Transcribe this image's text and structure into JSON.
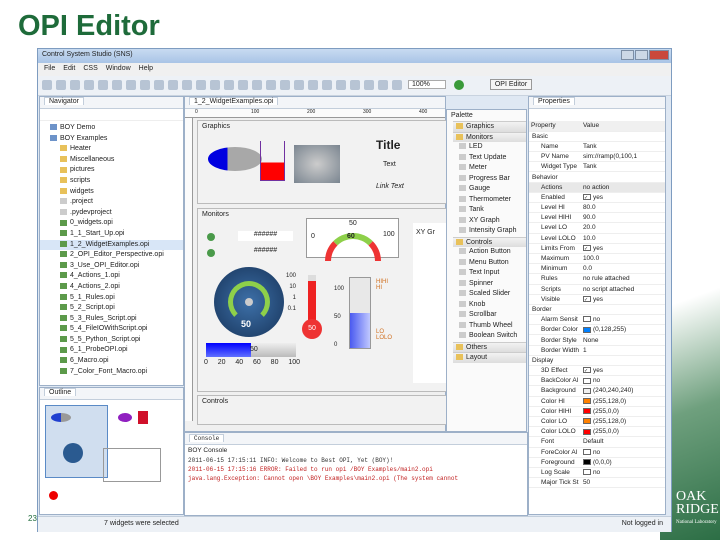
{
  "slide": {
    "title": "OPI Editor",
    "page_number": "23",
    "logo_text": "OAK RIDGE",
    "logo_sub": "National Laboratory"
  },
  "window": {
    "title": "Control System Studio (SNS)",
    "menu": [
      "File",
      "Edit",
      "CSS",
      "Window",
      "Help"
    ],
    "zoom": "100%",
    "perspective": "OPI Editor"
  },
  "navigator": {
    "tab": "Navigator",
    "items": [
      {
        "label": "BOY Demo",
        "type": "project",
        "indent": 1
      },
      {
        "label": "BOY Examples",
        "type": "project",
        "indent": 1
      },
      {
        "label": "Heater",
        "type": "folder",
        "indent": 2
      },
      {
        "label": "Miscellaneous",
        "type": "folder",
        "indent": 2
      },
      {
        "label": "pictures",
        "type": "folder",
        "indent": 2
      },
      {
        "label": "scripts",
        "type": "folder",
        "indent": 2
      },
      {
        "label": "widgets",
        "type": "folder",
        "indent": 2
      },
      {
        "label": ".project",
        "type": "file",
        "indent": 2
      },
      {
        "label": ".pydevproject",
        "type": "file",
        "indent": 2
      },
      {
        "label": "0_widgets.opi",
        "type": "opi",
        "indent": 2
      },
      {
        "label": "1_1_Start_Up.opi",
        "type": "opi",
        "indent": 2
      },
      {
        "label": "1_2_WidgetExamples.opi",
        "type": "opi",
        "indent": 2,
        "selected": true
      },
      {
        "label": "2_OPI_Editor_Perspective.opi",
        "type": "opi",
        "indent": 2
      },
      {
        "label": "3_Use_OPI_Editor.opi",
        "type": "opi",
        "indent": 2
      },
      {
        "label": "4_Actions_1.opi",
        "type": "opi",
        "indent": 2
      },
      {
        "label": "4_Actions_2.opi",
        "type": "opi",
        "indent": 2
      },
      {
        "label": "5_1_Rules.opi",
        "type": "opi",
        "indent": 2
      },
      {
        "label": "5_2_Script.opi",
        "type": "opi",
        "indent": 2
      },
      {
        "label": "5_3_Rules_Script.opi",
        "type": "opi",
        "indent": 2
      },
      {
        "label": "5_4_FileIOWithScript.opi",
        "type": "opi",
        "indent": 2
      },
      {
        "label": "5_5_Python_Script.opi",
        "type": "opi",
        "indent": 2
      },
      {
        "label": "6_1_ProbeOPI.opi",
        "type": "opi",
        "indent": 2
      },
      {
        "label": "6_Macro.opi",
        "type": "opi",
        "indent": 2
      },
      {
        "label": "7_Color_Font_Macro.opi",
        "type": "opi",
        "indent": 2
      }
    ]
  },
  "outline": {
    "tab": "Outline"
  },
  "editor": {
    "tab": "1_2_WidgetExamples.opi",
    "ruler": [
      "0",
      "100",
      "200",
      "300",
      "400"
    ],
    "graphics": {
      "label": "Graphics",
      "title": "Title",
      "text": "Text",
      "link": "Link Text"
    },
    "monitors": {
      "label": "Monitors",
      "text_updates": [
        "######",
        "######"
      ],
      "meter_ticks": [
        "0",
        "50",
        "100"
      ],
      "meter_value": "60",
      "gauge_ticks": [
        "0",
        "20",
        "40",
        "60",
        "80",
        "100"
      ],
      "gauge_value": "50",
      "thermo_ticks": [
        "100",
        "10",
        "1",
        "0.1"
      ],
      "thermo_value": "50",
      "tank_ticks": [
        "100",
        "50",
        "0"
      ],
      "tank_levels": [
        "HIHI",
        "HI",
        "LO",
        "LOLO"
      ],
      "progress_value": "50",
      "progress_ticks": [
        "0",
        "20",
        "40",
        "60",
        "80",
        "100"
      ],
      "xy_label": "XY Gr"
    },
    "controls": {
      "label": "Controls"
    },
    "level_fraction": 0.5
  },
  "palette": {
    "title": "Palette",
    "items": [
      {
        "label": "Graphics",
        "category": true
      },
      {
        "label": "Monitors",
        "category": true
      },
      {
        "label": "LED"
      },
      {
        "label": "Text Update"
      },
      {
        "label": "Meter"
      },
      {
        "label": "Progress Bar"
      },
      {
        "label": "Gauge"
      },
      {
        "label": "Thermometer"
      },
      {
        "label": "Tank"
      },
      {
        "label": "XY Graph"
      },
      {
        "label": "Intensity Graph"
      },
      {
        "label": "Controls",
        "category": true
      },
      {
        "label": "Action Button"
      },
      {
        "label": "Menu Button"
      },
      {
        "label": "Text Input"
      },
      {
        "label": "Spinner"
      },
      {
        "label": "Scaled Slider"
      },
      {
        "label": "Knob"
      },
      {
        "label": "Scrollbar"
      },
      {
        "label": "Thumb Wheel"
      },
      {
        "label": "Boolean Switch"
      },
      {
        "label": "Others",
        "category": true
      },
      {
        "label": "Layout",
        "category": true
      }
    ]
  },
  "properties": {
    "tab": "Properties",
    "headers": [
      "Property",
      "Value"
    ],
    "rows": [
      {
        "p": "Basic",
        "group": true
      },
      {
        "p": "Name",
        "v": "Tank"
      },
      {
        "p": "PV Name",
        "v": "sim://ramp(0,100,1"
      },
      {
        "p": "Widget Type",
        "v": "Tank"
      },
      {
        "p": "Behavior",
        "group": true
      },
      {
        "p": "Actions",
        "v": "no action"
      },
      {
        "p": "Enabled",
        "v": "yes",
        "check": true
      },
      {
        "p": "Level HI",
        "v": "80.0"
      },
      {
        "p": "Level HIHI",
        "v": "90.0"
      },
      {
        "p": "Level LO",
        "v": "20.0"
      },
      {
        "p": "Level LOLO",
        "v": "10.0"
      },
      {
        "p": "Limits From",
        "v": "yes",
        "check": true
      },
      {
        "p": "Maximum",
        "v": "100.0"
      },
      {
        "p": "Minimum",
        "v": "0.0"
      },
      {
        "p": "Rules",
        "v": "no rule attached"
      },
      {
        "p": "Scripts",
        "v": "no script attached"
      },
      {
        "p": "Visible",
        "v": "yes",
        "check": true
      },
      {
        "p": "Border",
        "group": true
      },
      {
        "p": "Alarm Sensit",
        "v": "no",
        "check": false
      },
      {
        "p": "Border Color",
        "v": "(0,128,255)",
        "color": "#0080ff"
      },
      {
        "p": "Border Style",
        "v": "None"
      },
      {
        "p": "Border Width",
        "v": "1"
      },
      {
        "p": "Display",
        "group": true
      },
      {
        "p": "3D Effect",
        "v": "yes",
        "check": true
      },
      {
        "p": "BackColor Al",
        "v": "no",
        "check": false
      },
      {
        "p": "Background",
        "v": "(240,240,240)",
        "color": "#f0f0f0"
      },
      {
        "p": "Color HI",
        "v": "(255,128,0)",
        "color": "#ff8000"
      },
      {
        "p": "Color HIHI",
        "v": "(255,0,0)",
        "color": "#ff0000"
      },
      {
        "p": "Color LO",
        "v": "(255,128,0)",
        "color": "#ff8000"
      },
      {
        "p": "Color LOLO",
        "v": "(255,0,0)",
        "color": "#ff0000"
      },
      {
        "p": "Font",
        "v": "Default"
      },
      {
        "p": "ForeColor Al",
        "v": "no",
        "check": false
      },
      {
        "p": "Foreground",
        "v": "(0,0,0)",
        "color": "#000000"
      },
      {
        "p": "Log Scale",
        "v": "no",
        "check": false
      },
      {
        "p": "Major Tick St",
        "v": "50"
      }
    ]
  },
  "console": {
    "tab": "Console",
    "title": "BOY Console",
    "lines": [
      {
        "text": "2011-06-15 17:15:11 INFO: Welcome to Best OPI, Yet (BOY)!",
        "error": false
      },
      {
        "text": "2011-06-15 17:15:16 ERROR: Failed to run opi /BOY Examples/main2.opi",
        "error": true
      },
      {
        "text": "java.lang.Exception: Cannot open \\BOY Examples\\main2.opi (The system cannot",
        "error": true
      }
    ]
  },
  "status": {
    "message": "7 widgets were selected",
    "login": "Not logged in"
  }
}
